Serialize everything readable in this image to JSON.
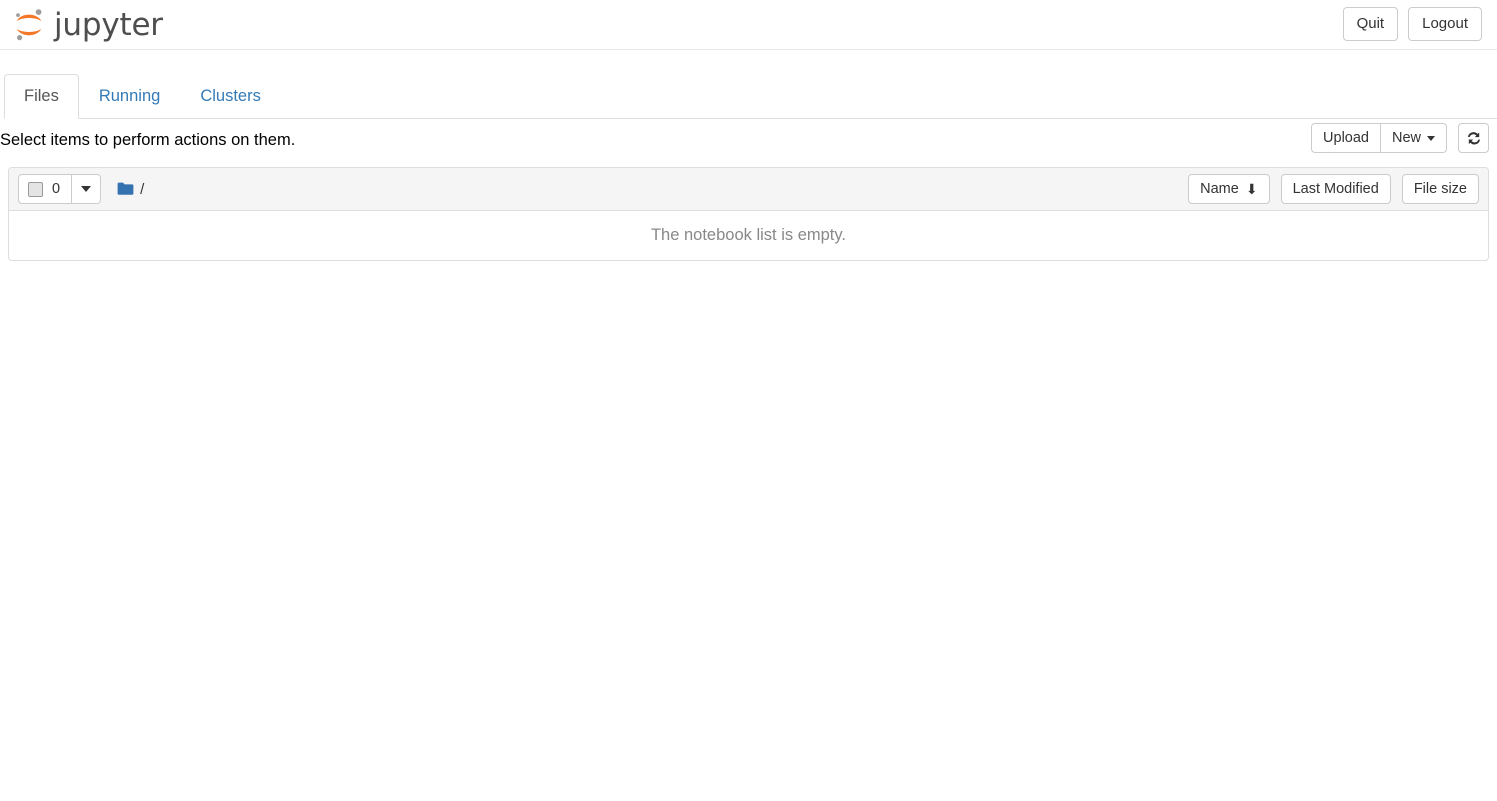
{
  "header": {
    "brand_text": "jupyter",
    "brand_icon": "jupyter-logo",
    "buttons": [
      {
        "label": "Quit",
        "name": "quit-button"
      },
      {
        "label": "Logout",
        "name": "logout-button"
      }
    ],
    "colors": {
      "logo_orange": "#f37726",
      "logo_gray": "#9e9e9e",
      "brand_text": "#4e4e4e"
    }
  },
  "tabs": [
    {
      "label": "Files",
      "active": true
    },
    {
      "label": "Running",
      "active": false
    },
    {
      "label": "Clusters",
      "active": false
    }
  ],
  "toolbar": {
    "message": "Select items to perform actions on them.",
    "upload_label": "Upload",
    "new_label": "New",
    "new_caret_icon": "caret-down-icon",
    "refresh_icon": "refresh-icon"
  },
  "file_list": {
    "selected_count": "0",
    "select_all_caret_icon": "caret-down-icon",
    "checkbox_icon": "checkbox-unchecked-icon",
    "folder_icon": "folder-icon",
    "breadcrumb_root": "/",
    "sort": {
      "name_label": "Name",
      "name_sort_icon": "arrow-down-icon",
      "name_sort_arrow": "⬇",
      "last_modified_label": "Last Modified",
      "file_size_label": "File size"
    },
    "empty_message": "The notebook list is empty."
  },
  "colors": {
    "link_blue": "#337ab7",
    "folder_blue": "#3572b0",
    "border_gray": "#dddddd",
    "header_bg": "#f5f5f5",
    "muted_text": "#888888"
  }
}
